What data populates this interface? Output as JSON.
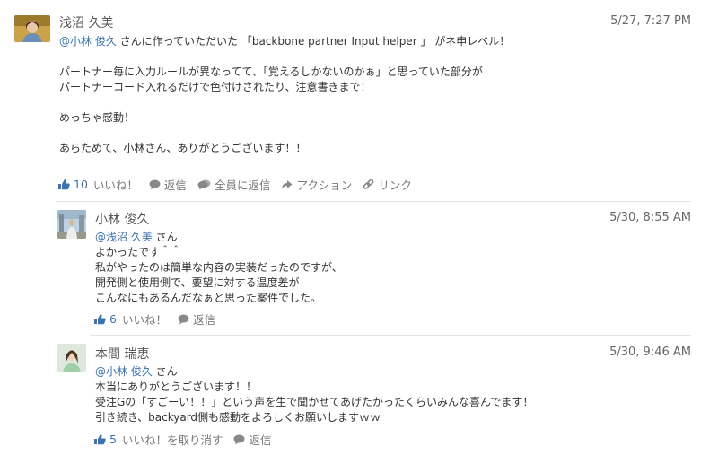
{
  "posts": [
    {
      "author": "浅沼 久美",
      "time": "5/27, 7:27 PM",
      "mention": "@小林 俊久",
      "lines": [
        " さんに作っていただいた 「backbone partner Input helper 」 がネ申レベル！",
        "",
        "パートナー毎に入力ルールが異なってて、「覚えるしかないのかぁ」と思っていた部分が",
        "パートナーコード入れるだけで色付けされたり、注意書きまで！",
        "",
        "めっちゃ感動！",
        "",
        "あらためて、小林さん、ありがとうございます！！"
      ],
      "like_count": "10",
      "actions": [
        "いいね！",
        "返信",
        "全員に返信",
        "アクション",
        "リンク"
      ]
    },
    {
      "author": "小林 俊久",
      "time": "5/30, 8:55 AM",
      "mention": "@浅沼 久美",
      "mention_suffix": " さん",
      "lines": [
        "よかったです＾＾",
        "私がやったのは簡単な内容の実装だったのですが、",
        "開発側と使用側で、要望に対する温度差が",
        "こんなにもあるんだなぁと思った案件でした。"
      ],
      "like_count": "6",
      "actions": [
        "いいね！",
        "返信"
      ]
    },
    {
      "author": "本間 瑞恵",
      "time": "5/30, 9:46 AM",
      "mention": "@小林 俊久",
      "mention_suffix": " さん",
      "lines": [
        "本当にありがとうございます！！",
        "受注Gの「すごーい！！」という声を生で聞かせてあげたかったくらいみんな喜んでます！",
        "引き続き、backyard側も感動をよろしくお願いしますｗｗ"
      ],
      "like_count": "5",
      "actions": [
        "いいね！を取り消す",
        "返信"
      ]
    }
  ],
  "colors": {
    "link": "#3b73af",
    "muted": "#777777",
    "divider": "#e4e4e4"
  }
}
